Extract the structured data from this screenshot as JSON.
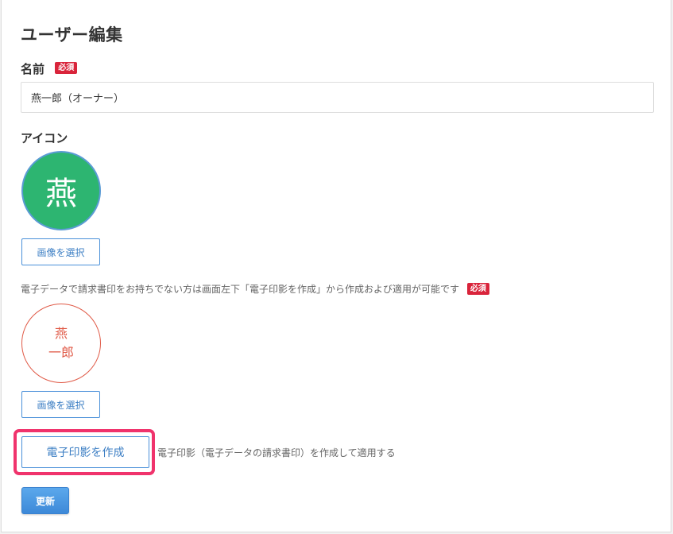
{
  "page": {
    "title": "ユーザー編集"
  },
  "name_field": {
    "label": "名前",
    "required_badge": "必須",
    "value": "燕一郎（オーナー）"
  },
  "icon_field": {
    "label": "アイコン",
    "avatar_char": "燕",
    "avatar_bg_color": "#2db571",
    "select_button": "画像を選択"
  },
  "seal_field": {
    "note": "電子データで請求書印をお持ちでない方は画面左下「電子印影を作成」から作成および適用が可能です",
    "required_badge": "必須",
    "seal_line1": "燕",
    "seal_line2": "一郎",
    "seal_color": "#e05a47",
    "select_button": "画像を選択"
  },
  "create_seal": {
    "button": "電子印影を作成",
    "description": "電子印影（電子データの請求書印）を作成して適用する",
    "highlight_color": "#f0336c"
  },
  "actions": {
    "update_button": "更新"
  },
  "colors": {
    "required": "#d9243b",
    "accent": "#4a90d9"
  }
}
